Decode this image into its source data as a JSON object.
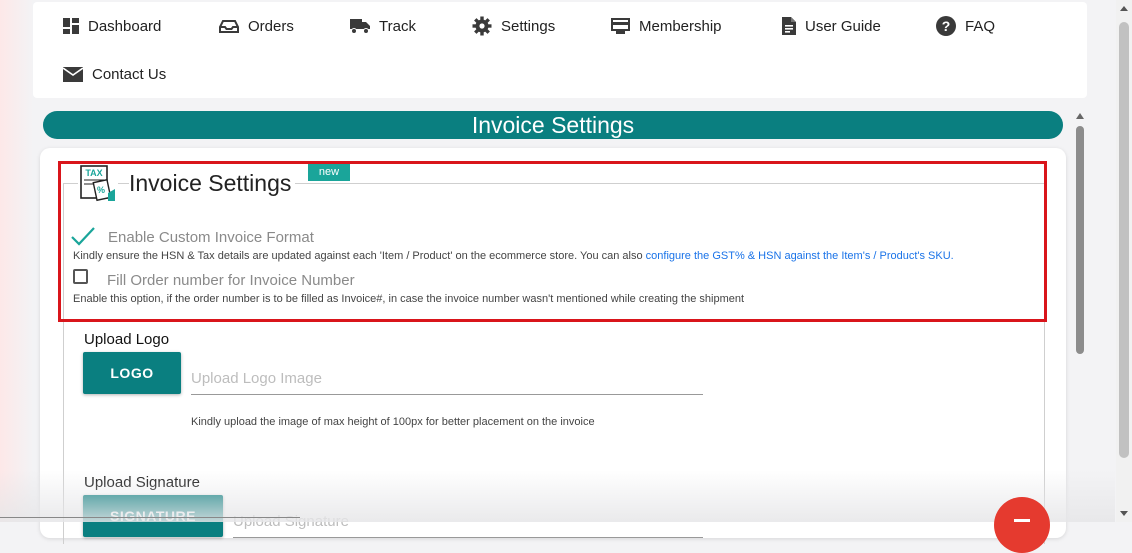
{
  "nav": {
    "items": [
      {
        "label": "Dashboard",
        "icon": "dashboard-icon"
      },
      {
        "label": "Orders",
        "icon": "inbox-tray-icon"
      },
      {
        "label": "Track",
        "icon": "truck-icon"
      },
      {
        "label": "Settings",
        "icon": "gear-icon"
      },
      {
        "label": "Membership",
        "icon": "card-icon"
      },
      {
        "label": "User Guide",
        "icon": "document-icon"
      },
      {
        "label": "FAQ",
        "icon": "question-circle-icon"
      },
      {
        "label": "Contact Us",
        "icon": "envelope-icon"
      }
    ]
  },
  "header": {
    "title": "Invoice Settings"
  },
  "settings": {
    "title": "Invoice Settings",
    "badge": "new",
    "icon": "tax-document-icon",
    "options": [
      {
        "label": "Enable Custom Invoice Format",
        "checked": true,
        "hint": "Kindly ensure the HSN & Tax details are updated against each 'Item / Product' on the ecommerce store. You can also ",
        "hint_link": "configure the GST% & HSN against the Item's / Product's SKU."
      },
      {
        "label": "Fill Order number for Invoice Number",
        "checked": false,
        "hint": "Enable this option, if the order number is to be filled as Invoice#, in case the invoice number wasn't mentioned while creating the shipment"
      }
    ]
  },
  "logo": {
    "label": "Upload Logo",
    "button": "LOGO",
    "placeholder": "Upload Logo Image",
    "hint": "Kindly upload the image of max height of 100px for better placement on the invoice"
  },
  "signature": {
    "label": "Upload Signature",
    "button": "SIGNATURE",
    "placeholder": "Upload Signature"
  },
  "colors": {
    "accent": "#0a7f80",
    "badge": "#1aa59a",
    "highlight": "#d9151b",
    "fab": "#e53a2f",
    "link": "#1a73e8"
  }
}
